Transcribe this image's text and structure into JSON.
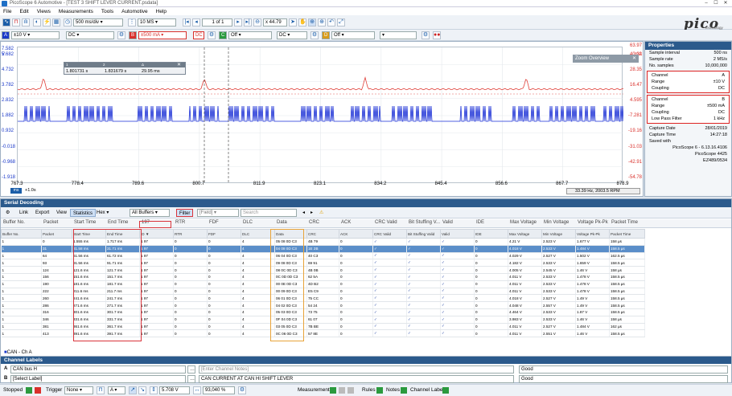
{
  "window": {
    "title": "PicoScope 6 Automotive - [TEST 3 SHIFT LEVER CURRENT.psdata]"
  },
  "menu": [
    "File",
    "Edit",
    "Views",
    "Measurements",
    "Tools",
    "Automotive",
    "Help"
  ],
  "toolbar": {
    "timebase": "500 ms/div",
    "samples": "10 MS",
    "page": "1 of 1",
    "zoom": "x 44.79",
    "channel_a": {
      "name": "A",
      "range": "±10 V",
      "coupling": "DC"
    },
    "channel_b": {
      "name": "B",
      "range": "±500 mA",
      "coupling": "DC"
    },
    "channel_c": {
      "name": "C",
      "state": "Off",
      "coupling": "DC"
    },
    "channel_d": {
      "name": "D",
      "state": "Off"
    }
  },
  "scope": {
    "left_axis": {
      "unit": "V",
      "ticks": [
        "5.682",
        "4.732",
        "3.782",
        "2.832",
        "1.882",
        "0.932",
        "-0.018",
        "-0.968",
        "-1.918"
      ],
      "top": "7.582"
    },
    "right_axis": {
      "unit": "mA",
      "ticks": [
        "40.22",
        "28.35",
        "16.47",
        "4.595",
        "-7.281",
        "-19.16",
        "-31.03",
        "-42.91",
        "-54.78"
      ],
      "top": "63.97"
    },
    "x_ticks": [
      "767.3",
      "778.4",
      "789.6",
      "800.7",
      "811.9",
      "823.1",
      "834.2",
      "845.4",
      "856.6",
      "867.7",
      "878.9"
    ],
    "x_unit": "ms",
    "x_offset": "+1.0s",
    "measurement_box": {
      "col1_head": "1",
      "col2_head": "2",
      "col3_head": "Δ",
      "v1": "1.801731 s",
      "v2": "1.831679 s",
      "v3": "29.95 ms"
    },
    "zoom_overview": "Zoom Overview",
    "freq_readout": "33.39 Hz, 2003.5 RPM"
  },
  "properties": {
    "title": "Properties",
    "general": [
      {
        "k": "Sample interval",
        "v": "500 ns"
      },
      {
        "k": "Sample rate",
        "v": "2 MS/s"
      },
      {
        "k": "No. samples",
        "v": "10,000,000"
      }
    ],
    "channel_a": [
      {
        "k": "Channel",
        "v": "A"
      },
      {
        "k": "Range",
        "v": "±10 V"
      },
      {
        "k": "Coupling",
        "v": "DC"
      }
    ],
    "channel_b": [
      {
        "k": "Channel",
        "v": "B"
      },
      {
        "k": "Range",
        "v": "±500 mA"
      },
      {
        "k": "Coupling",
        "v": "DC"
      },
      {
        "k": "Low Pass Filter",
        "v": "1 kHz"
      }
    ],
    "capture": [
      {
        "k": "Capture Date",
        "v": "28/01/2019"
      },
      {
        "k": "Capture Time",
        "v": "14:27:18"
      },
      {
        "k": "Saved with",
        "v": ""
      }
    ],
    "saved_lines": [
      "PicoScope 6 - 6.13.16.4106",
      "PicoScope 4425",
      "EZ489/0534"
    ]
  },
  "decode": {
    "title": "Serial Decoding",
    "tools": {
      "link": "Link",
      "export": "Export",
      "view": "View",
      "statistics": "Statistics",
      "hex": "Hex",
      "buffers": "All Buffers",
      "filter": "Filter",
      "field": "[Field]",
      "search": "Search"
    },
    "filter_headers": [
      "Buffer No.",
      "Packet",
      "Start Time",
      "End Time",
      "197",
      "RTR",
      "FDF",
      "DLC",
      "Data",
      "CRC",
      "ACK",
      "CRC Valid",
      "Bit Stuffing V...",
      "Valid",
      "IDE",
      "Max Voltage",
      "Min Voltage",
      "Voltage Pk-Pk",
      "Packet Time"
    ],
    "columns": [
      "Buffer No.",
      "Packet",
      "Start Time",
      "End Time",
      "ID ▼",
      "RTR",
      "FDF",
      "DLC",
      "Data",
      "CRC",
      "ACK",
      "CRC Valid",
      "Bit Stuffing Valid",
      "Valid",
      "IDE",
      "Max Voltage",
      "Min Voltage",
      "Voltage Pk-Pk",
      "Packet Time"
    ],
    "rows": [
      [
        "1",
        "0",
        "1.555 ms",
        "1.717 ms",
        "1 97",
        "0",
        "0",
        "4",
        "05 08 0D C3",
        "4B 79",
        "0",
        "✓",
        "✓",
        "✓",
        "0",
        "4.21 V",
        "2.523 V",
        "1.677 V",
        "158 µs"
      ],
      [
        "1",
        "31",
        "31.58 ms",
        "31.71 ms",
        "1 97",
        "0",
        "0",
        "4",
        "04 08 0D C3",
        "1E 2B",
        "0",
        "✓",
        "✓",
        "✓",
        "0",
        "4.018 V",
        "2.533 V",
        "1.484 V",
        "158.5 µs"
      ],
      [
        "1",
        "64",
        "61.56 ms",
        "61.72 ms",
        "1 97",
        "0",
        "0",
        "4",
        "06 04 0D C3",
        "40 C3",
        "0",
        "✓",
        "✓",
        "✓",
        "0",
        "4.029 V",
        "2.527 V",
        "1.502 V",
        "162.5 µs"
      ],
      [
        "1",
        "93",
        "91.56 ms",
        "91.71 ms",
        "1 97",
        "0",
        "0",
        "4",
        "09 08 0D C3",
        "69 91",
        "0",
        "✓",
        "✓",
        "✓",
        "0",
        "4.182 V",
        "2.533 V",
        "1.659 V",
        "158.5 µs"
      ],
      [
        "1",
        "124",
        "121.6 ms",
        "121.7 ms",
        "1 97",
        "0",
        "0",
        "4",
        "08 0C 0D C3",
        "4B 0B",
        "0",
        "✓",
        "✓",
        "✓",
        "0",
        "4.005 V",
        "2.545 V",
        "1.46 V",
        "158 µs"
      ],
      [
        "1",
        "156",
        "151.6 ms",
        "151.7 ms",
        "1 97",
        "0",
        "0",
        "4",
        "0C 0D 0D C3",
        "62 5A",
        "0",
        "✓",
        "✓",
        "✓",
        "0",
        "4.011 V",
        "2.533 V",
        "1.478 V",
        "158.5 µs"
      ],
      [
        "1",
        "190",
        "181.6 ms",
        "181.7 ms",
        "1 97",
        "0",
        "0",
        "4",
        "00 0E 0D C3",
        "4D B2",
        "0",
        "✓",
        "✓",
        "✓",
        "0",
        "4.011 V",
        "2.533 V",
        "1.478 V",
        "158.5 µs"
      ],
      [
        "1",
        "222",
        "211.6 ms",
        "211.7 ms",
        "1 97",
        "0",
        "0",
        "4",
        "00 09 0D C3",
        "E5 C9",
        "0",
        "✓",
        "✓",
        "✓",
        "0",
        "4.011 V",
        "2.533 V",
        "1.478 V",
        "158.5 µs"
      ],
      [
        "1",
        "260",
        "241.6 ms",
        "241.7 ms",
        "1 97",
        "0",
        "0",
        "4",
        "06 01 0D C3",
        "75 CC",
        "0",
        "✓",
        "✓",
        "✓",
        "0",
        "4.018 V",
        "2.527 V",
        "1.49 V",
        "158.5 µs"
      ],
      [
        "1",
        "286",
        "271.6 ms",
        "271.7 ms",
        "1 97",
        "0",
        "0",
        "4",
        "04 02 0D C3",
        "54 24",
        "0",
        "✓",
        "✓",
        "✓",
        "0",
        "4.048 V",
        "2.557 V",
        "1.49 V",
        "158.5 µs"
      ],
      [
        "1",
        "316",
        "301.6 ms",
        "301.7 ms",
        "1 97",
        "0",
        "0",
        "4",
        "05 03 0D C3",
        "73 75",
        "0",
        "✓",
        "✓",
        "✓",
        "0",
        "4.464 V",
        "2.533 V",
        "1.87 V",
        "158.5 µs"
      ],
      [
        "1",
        "346",
        "331.6 ms",
        "331.7 ms",
        "1 97",
        "0",
        "0",
        "4",
        "0F 04 0D C3",
        "61 07",
        "0",
        "✓",
        "✓",
        "✓",
        "0",
        "3.983 V",
        "2.533 V",
        "1.46 V",
        "158 µs"
      ],
      [
        "1",
        "381",
        "361.6 ms",
        "361.7 ms",
        "1 97",
        "0",
        "0",
        "4",
        "03 05 0D C3",
        "7B BE",
        "0",
        "✓",
        "✓",
        "✓",
        "0",
        "4.011 V",
        "2.527 V",
        "1.484 V",
        "162 µs"
      ],
      [
        "1",
        "413",
        "391.6 ms",
        "391.7 ms",
        "1 97",
        "0",
        "0",
        "4",
        "0C 06 0D C3",
        "57 8E",
        "0",
        "✓",
        "✓",
        "✓",
        "0",
        "4.011 V",
        "2.551 V",
        "1.46 V",
        "158.5 µs"
      ]
    ],
    "footer": "CAN - Ch A"
  },
  "channel_labels": {
    "title": "Channel Labels",
    "rows": [
      {
        "ch": "A",
        "label": "CAN bus H",
        "note": "[Enter Channel Notes]",
        "status": "Good"
      },
      {
        "ch": "B",
        "label": "[Select Label]",
        "note": "CAN CURRENT AT CAN HI SHIFT LEVER",
        "status": "Good"
      }
    ]
  },
  "status": {
    "state": "Stopped",
    "trigger_label": "Trigger",
    "trigger_mode": "None",
    "trigger_ch": "A",
    "level": "5.708 V",
    "pretrigger": "93,040 %",
    "measurements": "Measurements",
    "rules": "Rules",
    "notes": "Notes",
    "channel_labels": "Channel Labels"
  },
  "brand": {
    "logo": "pico",
    "sub": "Technology"
  }
}
